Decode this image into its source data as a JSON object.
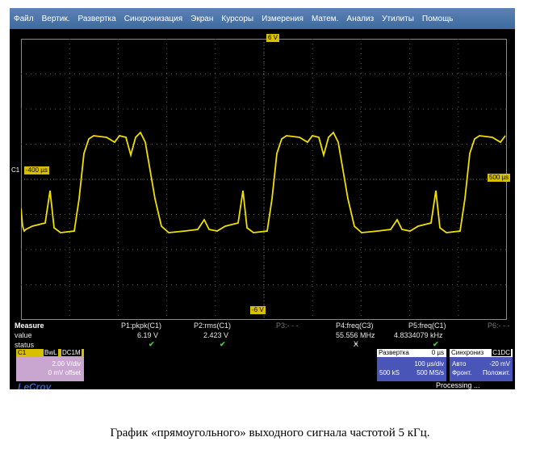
{
  "menu": [
    "Файл",
    "Вертик.",
    "Развертка",
    "Синхронизация",
    "Экран",
    "Курсоры",
    "Измерения",
    "Матем.",
    "Анализ",
    "Утилиты",
    "Помощь"
  ],
  "markers": {
    "top": "6 V",
    "bottom": "-6 V",
    "left": "-400 µs",
    "right": "500 µs",
    "left_label": "C1"
  },
  "measure": {
    "title": "Measure",
    "row_value": "value",
    "row_status": "status",
    "p1": {
      "name": "P1:pkpk(C1)",
      "value": "6.19 V"
    },
    "p2": {
      "name": "P2:rms(C1)",
      "value": "2.423 V"
    },
    "p3": {
      "name": "P3:- - -"
    },
    "p4": {
      "name": "P4:freq(C3)",
      "value": "55.556 MHz"
    },
    "p5": {
      "name": "P5:freq(C1)",
      "value": "4.8334079 kHz"
    },
    "p6": {
      "name": "P6:- - -"
    },
    "check": "✔",
    "warn": "Ӿ"
  },
  "ch1": {
    "label": "C1",
    "bwl": "BwL",
    "coupling": "DC1M",
    "vdiv": "2.00 V/div",
    "offset": "0 mV offset"
  },
  "timebase": {
    "title": "Развертка",
    "delay": "0 µs",
    "tdiv": "100 µs/div",
    "samples": "500 kS",
    "rate": "500 MS/s"
  },
  "trigger": {
    "title": "Синхрониз",
    "tag": "C1DC",
    "mode": "Авто",
    "level": "-20 mV",
    "slope": "Фронт.",
    "slope_val": "Положит."
  },
  "logo": "LeCroy",
  "status": "Processing ...",
  "caption": "График «прямоугольного» выходного сигнала частотой 5 кГц.",
  "colors": {
    "trace": "#f0e000",
    "menubar": "#4a74a8",
    "screen": "#000000",
    "ch1": "#c8a6cf",
    "panel": "#4a55b8"
  }
}
